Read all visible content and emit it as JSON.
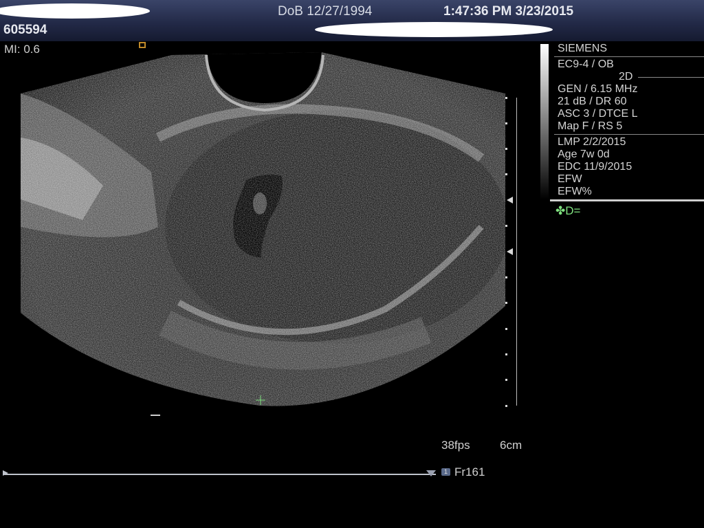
{
  "header": {
    "patient_id": "605594",
    "dob": "DoB 12/27/1994",
    "datetime": "1:47:36 PM 3/23/2015"
  },
  "overlay": {
    "mi": "MI: 0.6",
    "fps": "38fps",
    "depth": "6cm",
    "frame": "Fr161",
    "frame_icon": "1"
  },
  "panel": {
    "brand": "SIEMENS",
    "transducer": "EC9-4 / OB",
    "mode": "2D",
    "freq": "GEN / 6.15 MHz",
    "gain": "21 dB / DR 60",
    "asc": "ASC 3 / DTCE L",
    "map": "Map F / RS 5",
    "lmp": "LMP 2/2/2015",
    "age": "Age 7w 0d",
    "edc": "EDC 11/9/2015",
    "efw": "EFW",
    "efw_pct": "EFW%",
    "measurement": "✤D="
  },
  "colors": {
    "header_bg": "#2a3152",
    "measurement": "#7fe07f",
    "probe_marker": "#c08a2a"
  },
  "icons": [
    "probe-orientation-icon",
    "cine-play-icon",
    "cine-end-icon",
    "frame-number-icon",
    "caliper-cross-icon",
    "depth-marker-icon"
  ]
}
